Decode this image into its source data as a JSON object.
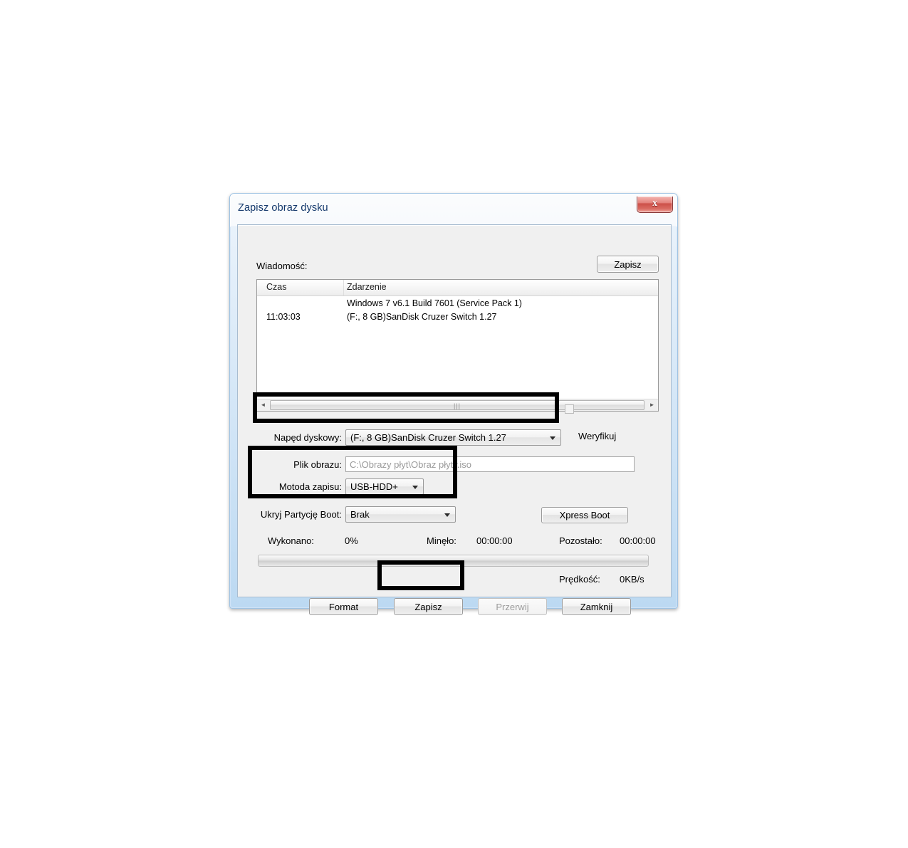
{
  "window": {
    "title": "Zapisz obraz dysku",
    "close_label": "x"
  },
  "message_section": {
    "label": "Wiadomość:",
    "save_log_button": "Zapisz"
  },
  "log": {
    "columns": [
      "Czas",
      "Zdarzenie"
    ],
    "rows": [
      {
        "time": "",
        "event": "Windows 7 v6.1 Build 7601 (Service Pack 1)"
      },
      {
        "time": "11:03:03",
        "event": "(F:, 8 GB)SanDisk Cruzer Switch   1.27"
      }
    ],
    "scrollbar": {
      "left_arrow": "◄",
      "right_arrow": "►",
      "grip": "|||"
    }
  },
  "drive": {
    "label": "Napęd dyskowy:",
    "value": "(F:, 8 GB)SanDisk Cruzer Switch   1.27",
    "verify_label": "Weryfikuj",
    "verify_checked": false
  },
  "image_file": {
    "label": "Plik obrazu:",
    "value": "C:\\Obrazy płyt\\Obraz płyty.iso"
  },
  "write_method": {
    "label": "Motoda zapisu:",
    "value": "USB-HDD+"
  },
  "hide_boot": {
    "label": "Ukryj Partycję Boot:",
    "value": "Brak"
  },
  "xpress_boot_button": "Xpress Boot",
  "status": {
    "done_label": "Wykonano:",
    "done_value": "0%",
    "elapsed_label": "Minęło:",
    "elapsed_value": "00:00:00",
    "remaining_label": "Pozostało:",
    "remaining_value": "00:00:00",
    "speed_label": "Prędkość:",
    "speed_value": "0KB/s",
    "progress_percent": 0
  },
  "buttons": {
    "format": "Format",
    "write": "Zapisz",
    "abort": "Przerwij",
    "close": "Zamknij"
  },
  "colors": {
    "highlight": "#000000",
    "title_text": "#13386b",
    "close_button": "#cc4f48",
    "dialog_face": "#f0f0f0"
  }
}
